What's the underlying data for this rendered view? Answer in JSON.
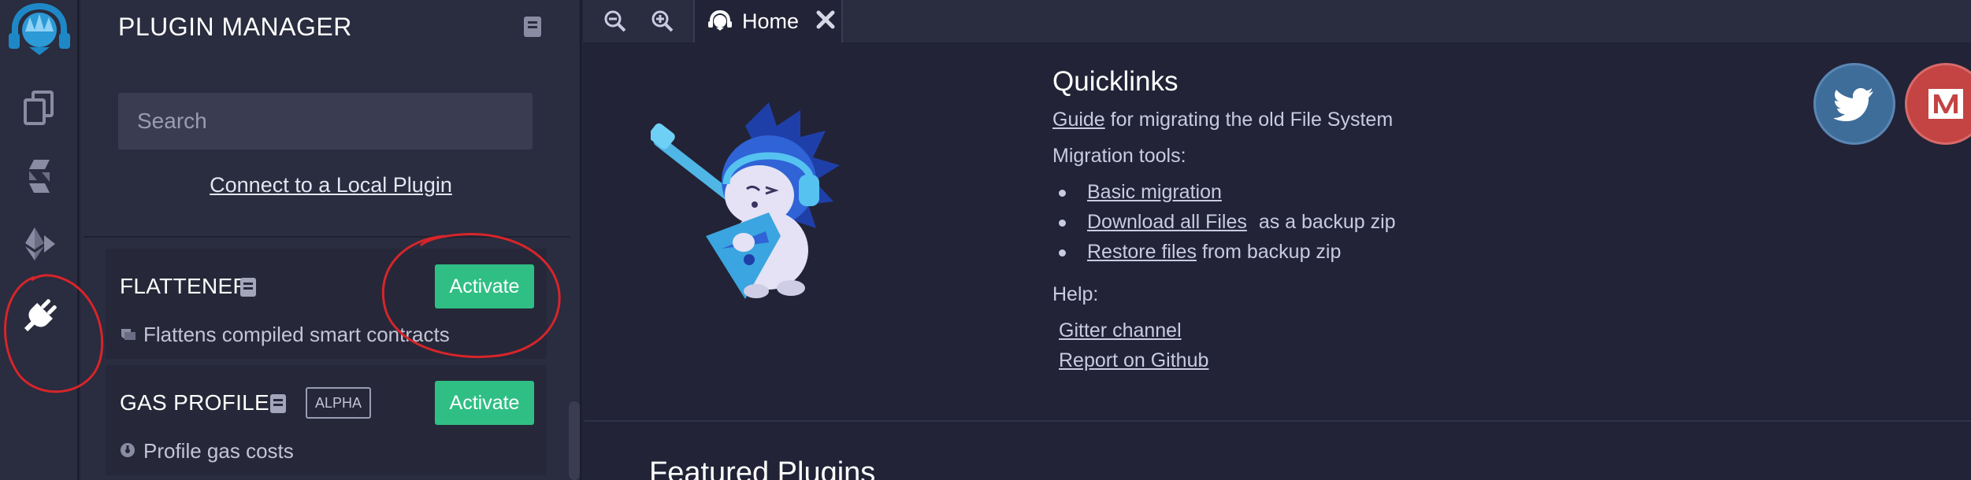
{
  "plugin_manager": {
    "title": "PLUGIN MANAGER",
    "search_placeholder": "Search",
    "connect_label": "Connect to a Local Plugin",
    "plugins": [
      {
        "name": "FLATTENER",
        "description": "Flattens compiled smart contracts",
        "action": "Activate"
      },
      {
        "name": "GAS PROFILER",
        "badge": "ALPHA",
        "description": "Profile gas costs",
        "action": "Activate"
      }
    ]
  },
  "tabs": {
    "home_label": "Home"
  },
  "home": {
    "quicklinks_title": "Quicklinks",
    "guide_link": "Guide",
    "guide_text": "for migrating the old File System",
    "migration_title": "Migration tools:",
    "migration_items": [
      {
        "link": "Basic migration",
        "text": ""
      },
      {
        "link": "Download all Files",
        "text": "as a backup zip"
      },
      {
        "link": "Restore files",
        "text": "from backup zip"
      }
    ],
    "help_title": "Help:",
    "help_links": [
      "Gitter channel",
      "Report on Github"
    ],
    "featured_title": "Featured Plugins"
  },
  "colors": {
    "activate": "#2fbf84",
    "twitter": "#3f6d9a",
    "medium": "#c44343",
    "annotation": "#d6252a"
  }
}
